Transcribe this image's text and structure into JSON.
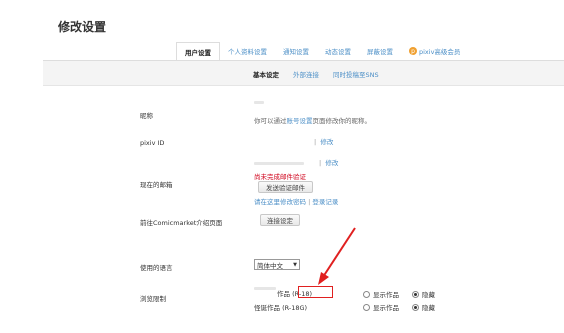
{
  "page_title": "修改设置",
  "tabs": [
    {
      "label": "用户设置",
      "active": true
    },
    {
      "label": "个人资料设置",
      "active": false
    },
    {
      "label": "通知设置",
      "active": false
    },
    {
      "label": "动态设置",
      "active": false
    },
    {
      "label": "屏蔽设置",
      "active": false
    },
    {
      "label": "pixiv高级会员",
      "active": false,
      "icon": "premium-icon"
    }
  ],
  "subnav": [
    {
      "label": "基本设定",
      "active": true
    },
    {
      "label": "外部连接",
      "active": false
    },
    {
      "label": "同时投稿至SNS",
      "active": false
    }
  ],
  "nickname": {
    "label": "昵称",
    "hint_prefix": "你可以通过",
    "hint_link": "账号设置",
    "hint_suffix": "页面修改你的昵称。"
  },
  "pixiv_id": {
    "label": "pixiv ID",
    "separator": "|",
    "edit_link": "修改"
  },
  "email": {
    "label": "现在的邮箱",
    "separator": "|",
    "edit_link": "修改",
    "warning": "尚未完成邮件验证",
    "send_button": "发送验证邮件",
    "change_link": "请在这里修改密码",
    "separator2": "|",
    "login_history_link": "登录记录"
  },
  "comicmarket": {
    "label": "前往Comicmarket介绍页面",
    "button": "连接设定"
  },
  "language": {
    "label": "使用的语言",
    "selected": "简体中文"
  },
  "browsing": {
    "label": "浏览限制",
    "rows": [
      {
        "label_visible": "作品",
        "tag": "(R-18)",
        "options": [
          "显示作品",
          "隐藏"
        ],
        "selected": 1
      },
      {
        "label_visible": "怪诞作品",
        "tag": "(R-18G)",
        "options": [
          "显示作品",
          "隐藏"
        ],
        "selected": 1
      }
    ]
  },
  "colors": {
    "link": "#4c8fc7",
    "warning": "#d0021b",
    "annotation": "#e02020"
  }
}
